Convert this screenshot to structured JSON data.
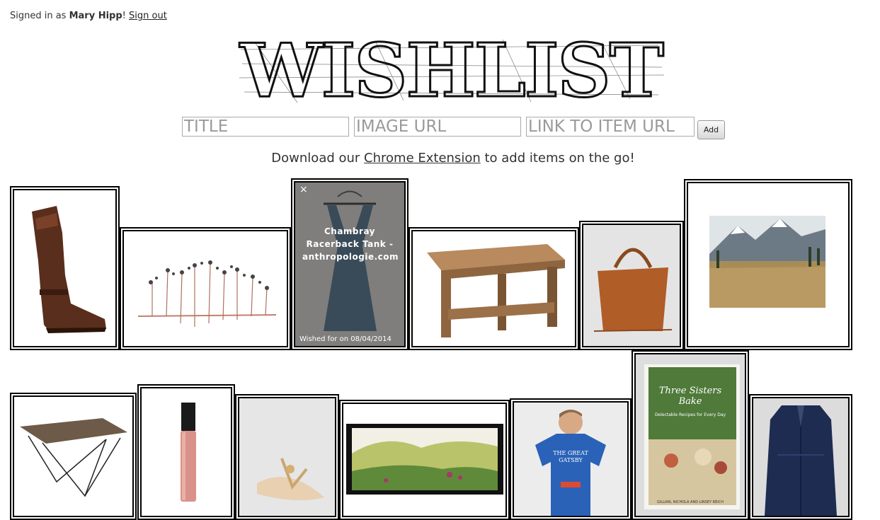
{
  "header": {
    "signed_in_prefix": "Signed in as ",
    "user_name": "Mary Hipp",
    "exclaim": "!",
    "sign_out": "Sign out"
  },
  "logo": {
    "text": "WISHLIST"
  },
  "form": {
    "title_placeholder": "TITLE",
    "image_placeholder": "IMAGE URL",
    "link_placeholder": "LINK TO ITEM URL",
    "add_label": "Add"
  },
  "download": {
    "prefix": "Download our ",
    "link": "Chrome Extension",
    "suffix": " to add items on the go!"
  },
  "items": [
    {
      "icon": "boot-image"
    },
    {
      "icon": "tree-sculpture-image"
    },
    {
      "icon": "tank-top-image",
      "title": "Chambray Racerback Tank - anthropologie.com",
      "date": "Wished for on 08/04/2014",
      "close": "×"
    },
    {
      "icon": "wooden-table-image"
    },
    {
      "icon": "leather-handbag-image"
    },
    {
      "icon": "mountain-landscape-image"
    },
    {
      "icon": "metal-table-image"
    },
    {
      "icon": "lip-gloss-image"
    },
    {
      "icon": "sandal-image"
    },
    {
      "icon": "landscape-painting-image"
    },
    {
      "icon": "gatsby-tshirt-image"
    },
    {
      "icon": "cookbook-image",
      "book_title": "Three Sisters Bake",
      "book_sub": "Delectable Recipes for Every Day",
      "book_authors": "GILLIAN, NICHOLA AND LINSEY REICH"
    },
    {
      "icon": "navy-jacket-image"
    }
  ],
  "colors": {
    "accent": "#000000",
    "background": "#ffffff",
    "overlay": "#3a3a3a"
  }
}
